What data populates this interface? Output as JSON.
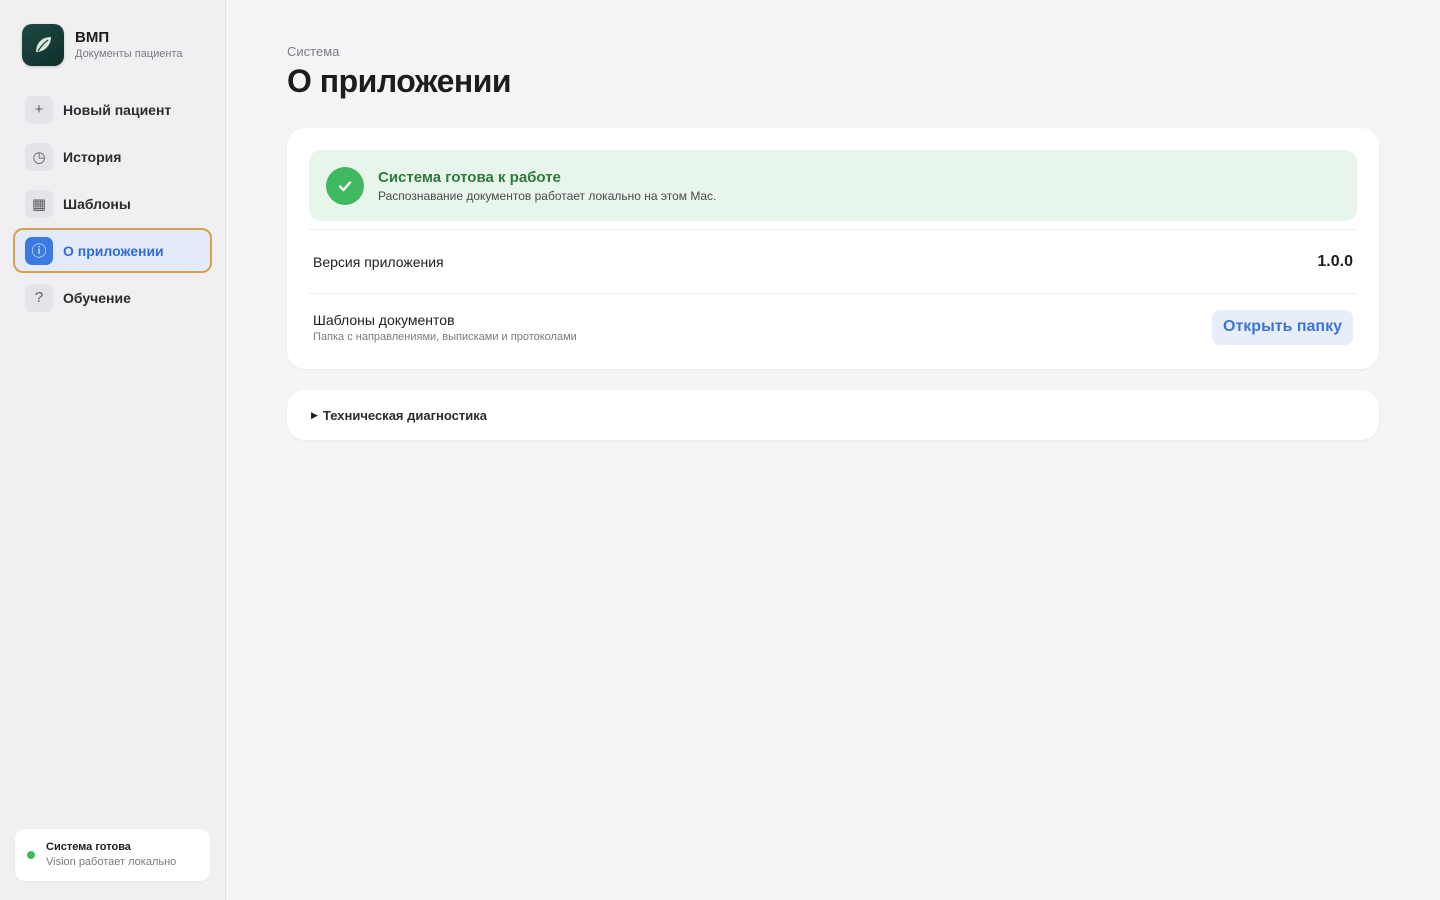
{
  "brand": {
    "title": "ВМП",
    "subtitle": "Документы пациента",
    "logo_icon": "leaf-logo-icon"
  },
  "sidebar": {
    "items": [
      {
        "label": "Новый пациент",
        "icon": "plus-icon",
        "glyph": "+",
        "active": false
      },
      {
        "label": "История",
        "icon": "clock-icon",
        "glyph": "◷",
        "active": false
      },
      {
        "label": "Шаблоны",
        "icon": "grid-icon",
        "glyph": "▦",
        "active": false
      },
      {
        "label": "О приложении",
        "icon": "info-icon",
        "glyph": "ⓘ",
        "active": true
      },
      {
        "label": "Обучение",
        "icon": "question-icon",
        "glyph": "?",
        "active": false
      }
    ],
    "status": {
      "title": "Система готова",
      "subtitle": "Vision работает локально",
      "color": "#3dbb5e"
    }
  },
  "header": {
    "breadcrumb": "Система",
    "title": "О приложении"
  },
  "main": {
    "status_banner": {
      "title": "Система готова к работе",
      "subtitle": "Распознавание документов работает локально на этом Mac.",
      "color": "#3fb85f"
    },
    "version": {
      "label": "Версия приложения",
      "value": "1.0.0"
    },
    "templates": {
      "label": "Шаблоны документов",
      "subtitle": "Папка с направлениями, выписками и протоколами",
      "button_label": "Открыть папку"
    },
    "diagnostics": {
      "label": "Техническая диагностика",
      "expanded": false
    }
  },
  "colors": {
    "accent": "#3b7ae0",
    "active_outline": "#d4a24c",
    "success": "#3fb85f"
  }
}
